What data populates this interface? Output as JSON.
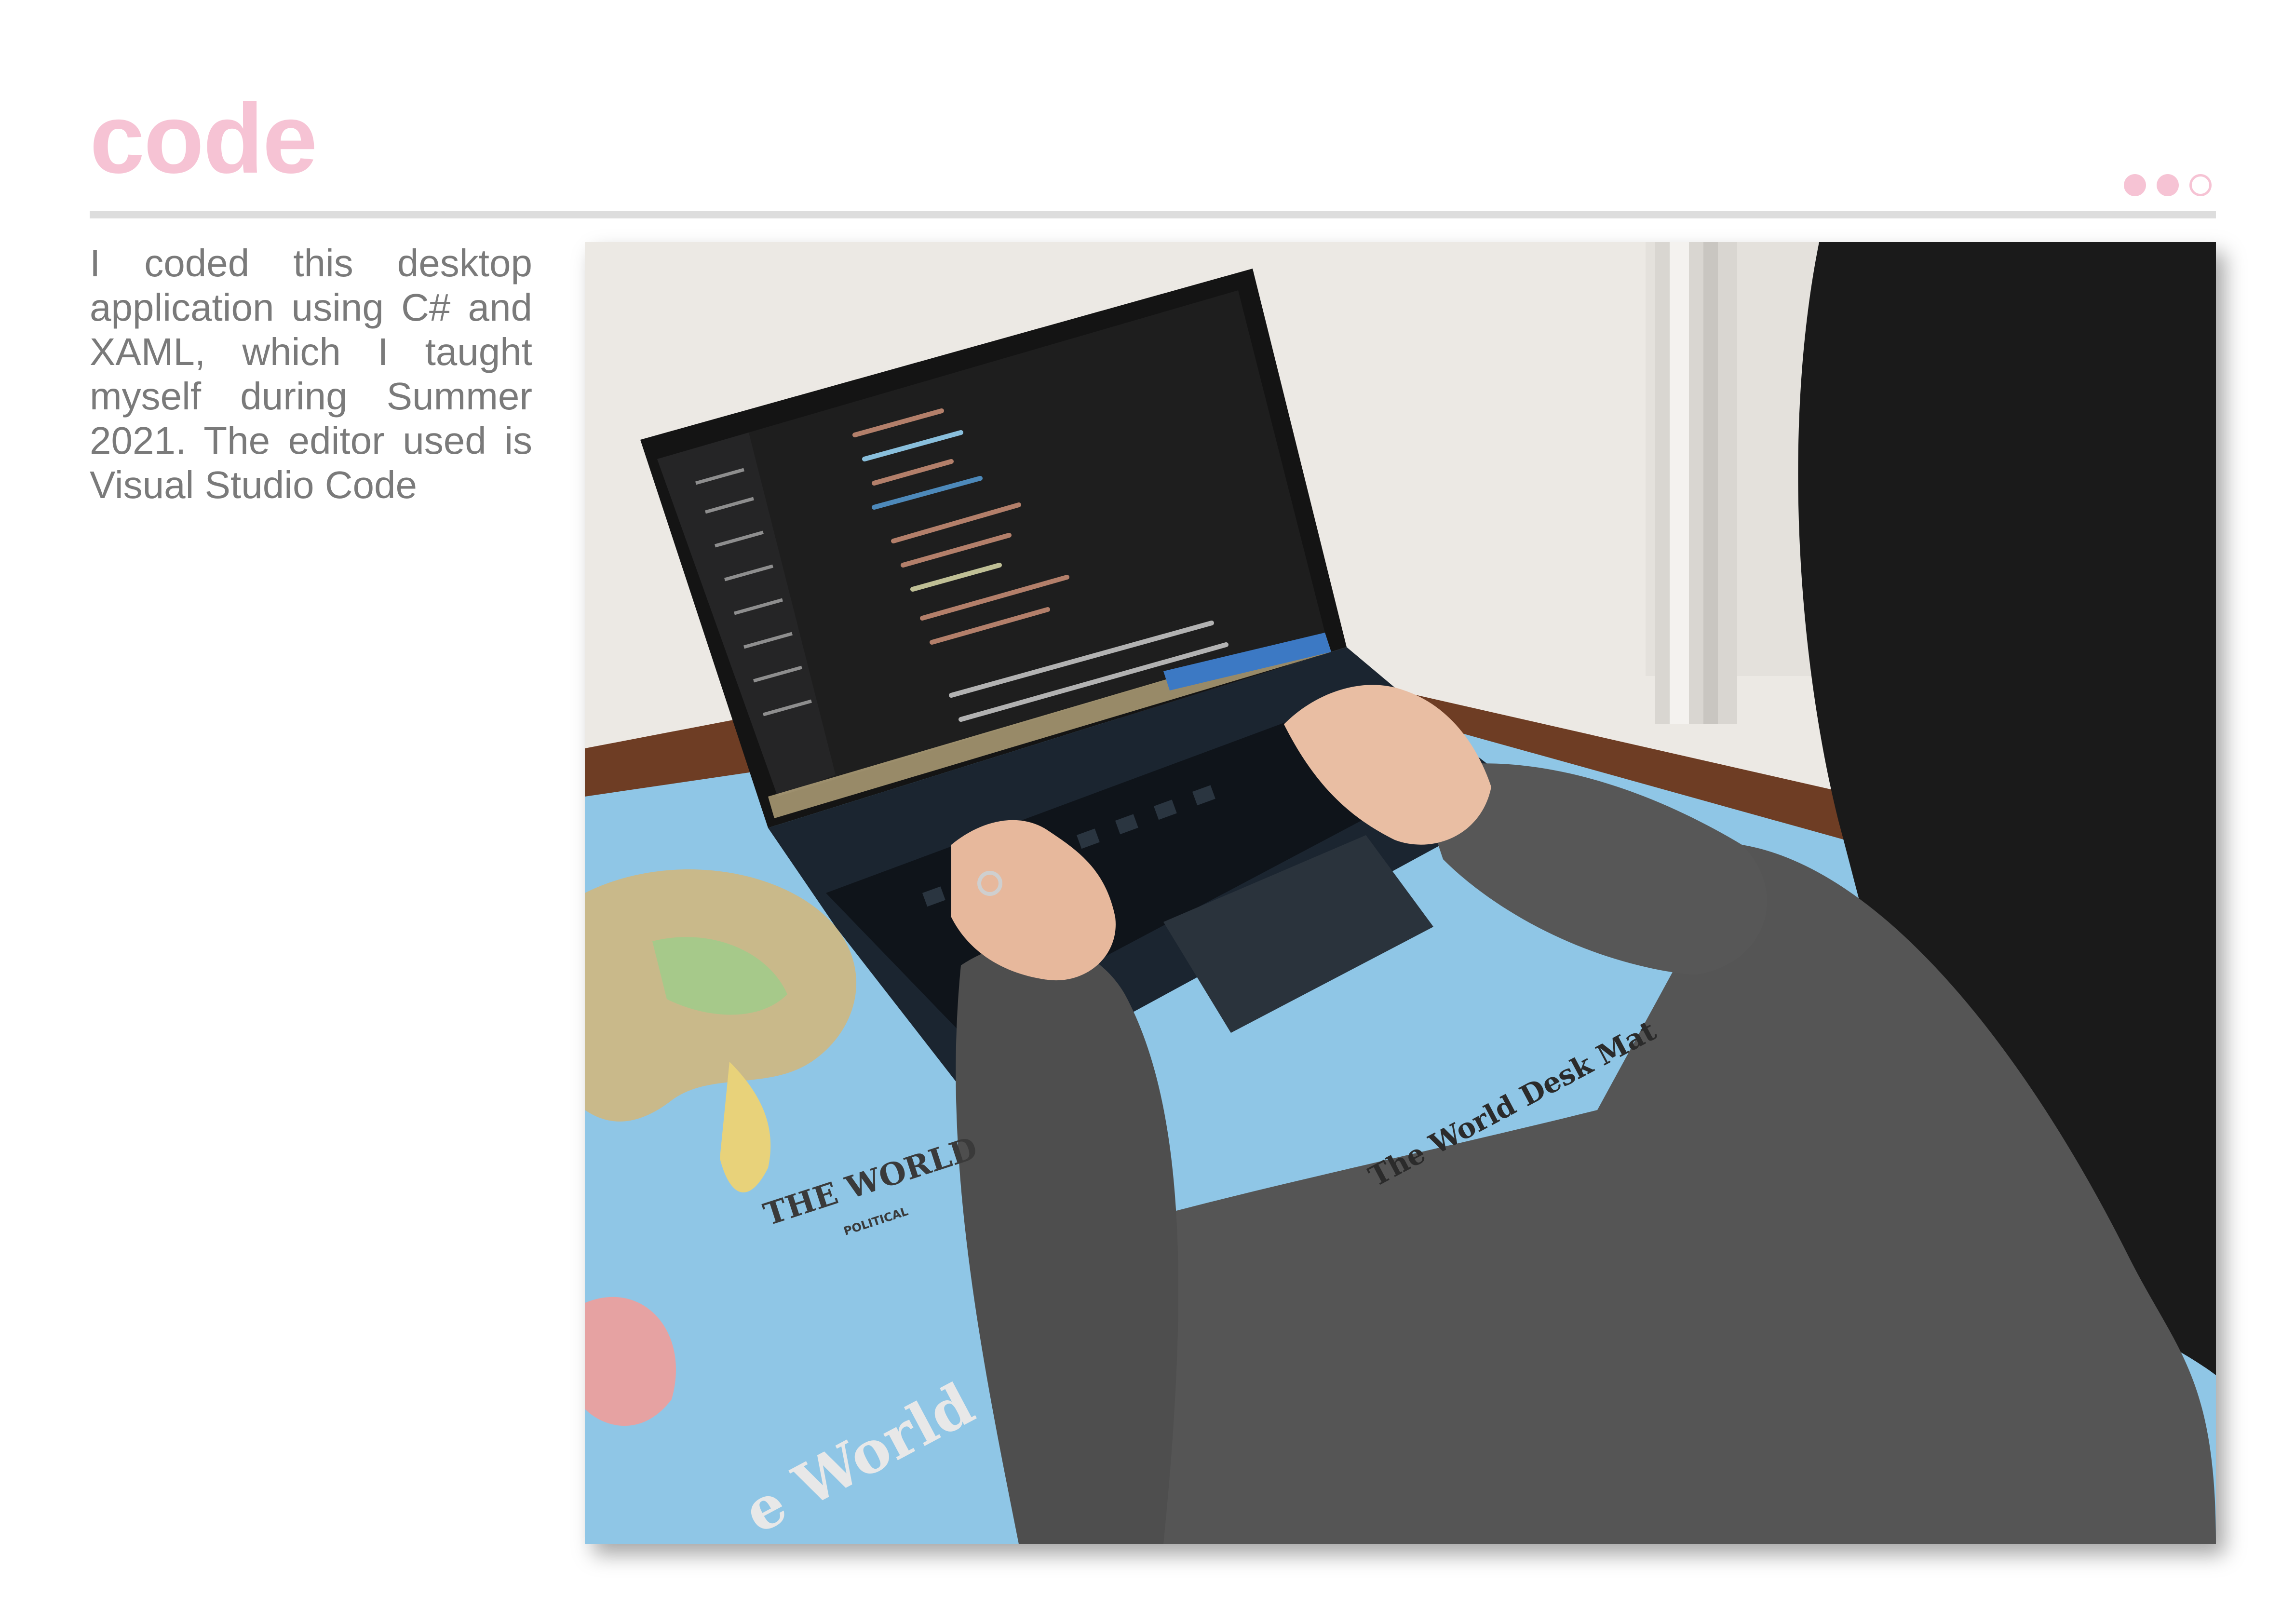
{
  "page": {
    "title": "code",
    "body": "I coded this desktop application using C# and XAML, which I taught myself during Summer 2021. The editor used is Visual Studio Code",
    "accent_color": "#f6c3d4",
    "rule_color": "#dddddd",
    "text_color": "#7a7a7a",
    "page_indicator": {
      "total": 3,
      "filled": 2
    }
  },
  "photo": {
    "desk_mat_text_1": "THE WORLD",
    "desk_mat_text_2": "POLITICAL",
    "desk_mat_text_3": "The World Desk Mat",
    "desk_mat_text_4": "e World"
  }
}
